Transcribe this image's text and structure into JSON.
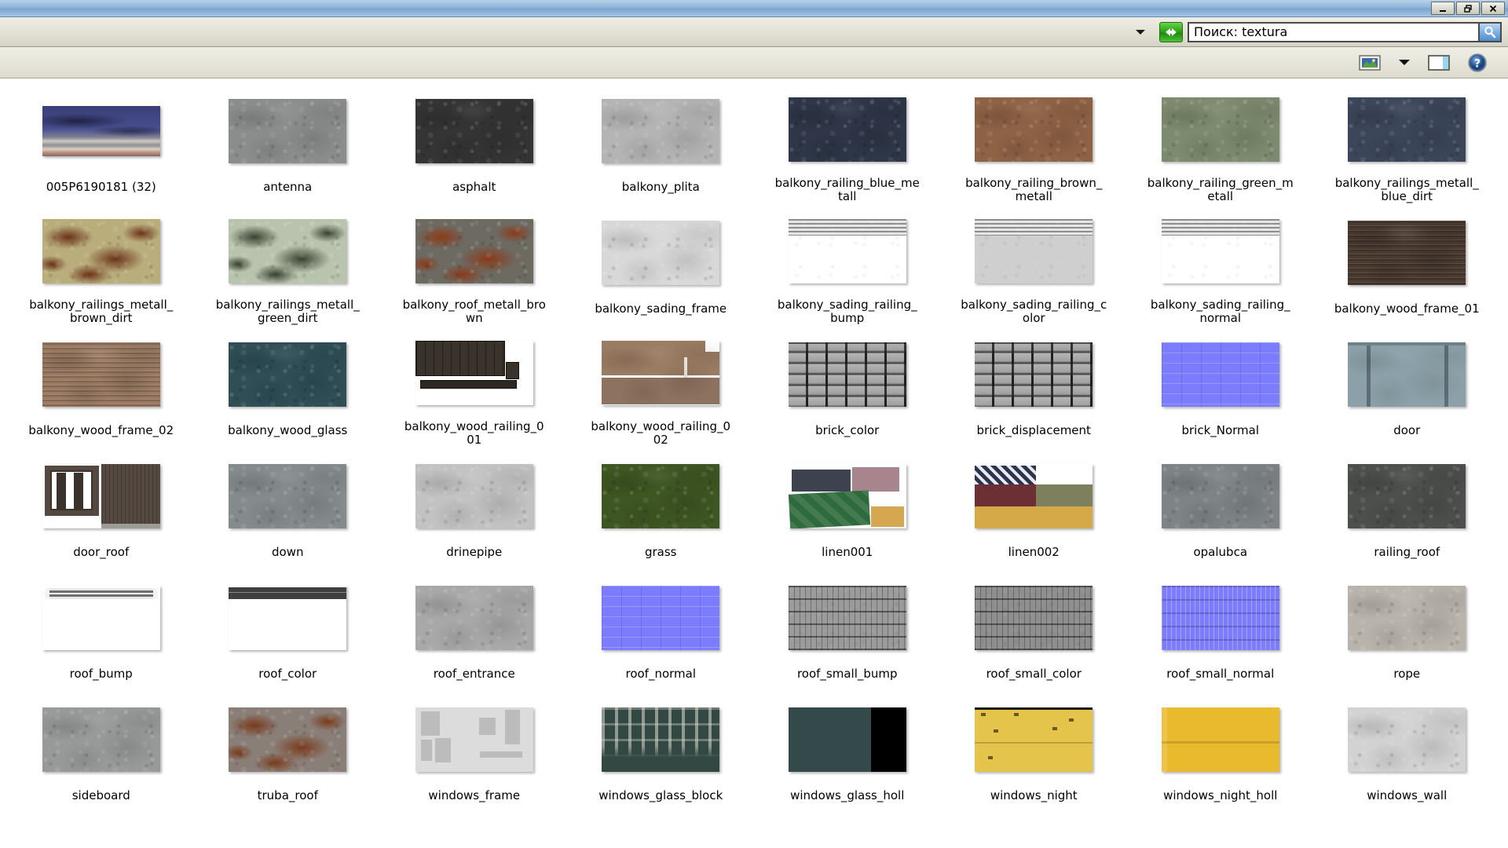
{
  "window": {
    "titlebar_buttons": [
      {
        "name": "minimize",
        "glyph": "_"
      },
      {
        "name": "restore",
        "glyph": "❐"
      },
      {
        "name": "close",
        "glyph": "✕"
      }
    ]
  },
  "addressbar": {
    "dropdown_icon": "chevron-down-icon",
    "refresh_icon": "refresh-icon",
    "search_value": "Поиск: textura",
    "search_placeholder": "Поиск",
    "search_icon": "magnifier-icon"
  },
  "toolbar": {
    "items": [
      {
        "name": "views-icon",
        "label": "Views"
      },
      {
        "name": "chevron-down-icon",
        "label": "More views"
      },
      {
        "name": "preview-pane-icon",
        "label": "Preview pane"
      },
      {
        "name": "help-icon",
        "label": "Help"
      }
    ]
  },
  "grid": {
    "columns": 8,
    "items": [
      {
        "label": "005P6190181 (32)",
        "kind": "sky"
      },
      {
        "label": "antenna",
        "kind": "solid",
        "color": "#8b8d8c"
      },
      {
        "label": "asphalt",
        "kind": "solid",
        "color": "#343434"
      },
      {
        "label": "balkony_plita",
        "kind": "solid",
        "color": "#b4b4b4"
      },
      {
        "label": "balkony_railing_blue_metall",
        "kind": "solid",
        "color": "#2e3647"
      },
      {
        "label": "balkony_railing_brown_metall",
        "kind": "solid",
        "color": "#8e6245"
      },
      {
        "label": "balkony_railing_green_metall",
        "kind": "solid",
        "color": "#7c8a6d"
      },
      {
        "label": "balkony_railings_metall_blue_dirt",
        "kind": "solid",
        "color": "#3c465a"
      },
      {
        "label": "balkony_railings_metall_brown_dirt",
        "kind": "rust",
        "color": "#b9ad7c",
        "color2": "#6b3218"
      },
      {
        "label": "balkony_railings_metall_green_dirt",
        "kind": "rust",
        "color": "#b9c4ae",
        "color2": "#3a4030"
      },
      {
        "label": "balkony_roof_metall_brown",
        "kind": "rust",
        "color": "#6d6a62",
        "color2": "#8c3a18"
      },
      {
        "label": "balkony_sading_frame",
        "kind": "solid",
        "color": "#d8d8d8"
      },
      {
        "label": "balkony_sading_railing_bump",
        "kind": "striped",
        "color": "#ffffff"
      },
      {
        "label": "balkony_sading_railing_color",
        "kind": "striped",
        "color": "#cfcfcf"
      },
      {
        "label": "balkony_sading_railing_normal",
        "kind": "striped",
        "color": "#ffffff"
      },
      {
        "label": "balkony_wood_frame_01",
        "kind": "woodgrain",
        "color": "#4a3a30"
      },
      {
        "label": "balkony_wood_frame_02",
        "kind": "woodgrain",
        "color": "#9b7a62"
      },
      {
        "label": "balkony_wood_glass",
        "kind": "solid",
        "color": "#2f4e56"
      },
      {
        "label": "balkony_wood_railing_001",
        "kind": "railing-dark",
        "color": "#3a332c"
      },
      {
        "label": "balkony_wood_railing_002",
        "kind": "railing-light",
        "color": "#9a7b63"
      },
      {
        "label": "brick_color",
        "kind": "brick"
      },
      {
        "label": "brick_displacement",
        "kind": "brick"
      },
      {
        "label": "brick_Normal",
        "kind": "normalmap",
        "color": "#7c7cff"
      },
      {
        "label": "door",
        "kind": "door",
        "color": "#8ba0a8"
      },
      {
        "label": "door_roof",
        "kind": "door-roof",
        "color": "#544840"
      },
      {
        "label": "down",
        "kind": "solid",
        "color": "#858a8c"
      },
      {
        "label": "drinepipe",
        "kind": "solid",
        "color": "#c2c2c2"
      },
      {
        "label": "grass",
        "kind": "solid",
        "color": "#3e5622"
      },
      {
        "label": "linen001",
        "kind": "linen001"
      },
      {
        "label": "linen002",
        "kind": "linen002"
      },
      {
        "label": "opalubca",
        "kind": "solid",
        "color": "#7e8385"
      },
      {
        "label": "railing_roof",
        "kind": "solid",
        "color": "#4d4f4d"
      },
      {
        "label": "roof_bump",
        "kind": "roof-bump",
        "color": "#ffffff"
      },
      {
        "label": "roof_color",
        "kind": "roof-color",
        "color": "#ffffff"
      },
      {
        "label": "roof_entrance",
        "kind": "solid",
        "color": "#a8a8a8"
      },
      {
        "label": "roof_normal",
        "kind": "normalmap",
        "color": "#7c7cff"
      },
      {
        "label": "roof_small_bump",
        "kind": "roofgrid",
        "color": "#9b9b9b"
      },
      {
        "label": "roof_small_color",
        "kind": "roofgrid",
        "color": "#8f8f8f"
      },
      {
        "label": "roof_small_normal",
        "kind": "normalgrid",
        "color": "#7c7cff"
      },
      {
        "label": "rope",
        "kind": "solid",
        "color": "#b8b4ac"
      },
      {
        "label": "sideboard",
        "kind": "solid",
        "color": "#989a99"
      },
      {
        "label": "truba_roof",
        "kind": "rust",
        "color": "#8a7f78",
        "color2": "#7a3a1c"
      },
      {
        "label": "windows_frame",
        "kind": "frames",
        "color": "#dcdcdc"
      },
      {
        "label": "windows_glass_block",
        "kind": "glassblock",
        "color": "#344843"
      },
      {
        "label": "windows_glass_holl",
        "kind": "glasshall",
        "color": "#34494a"
      },
      {
        "label": "windows_night",
        "kind": "night",
        "color": "#e4c44a"
      },
      {
        "label": "windows_night_holl",
        "kind": "nighthall",
        "color": "#eaba2e"
      },
      {
        "label": "windows_wall",
        "kind": "solid",
        "color": "#d2d2d2"
      }
    ]
  }
}
